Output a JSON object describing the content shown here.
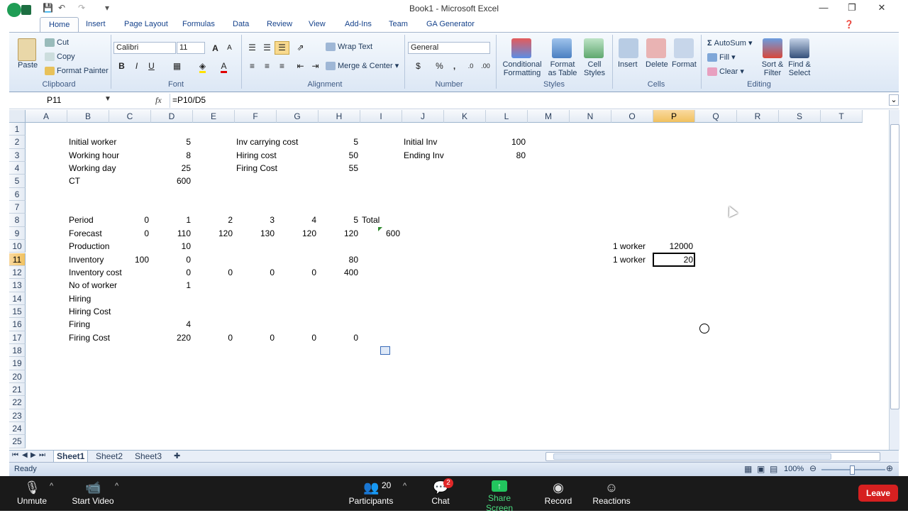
{
  "window": {
    "title": "Book1 - Microsoft Excel"
  },
  "ribbon_tabs": [
    "Home",
    "Insert",
    "Page Layout",
    "Formulas",
    "Data",
    "Review",
    "View",
    "Add-Ins",
    "Team",
    "GA Generator"
  ],
  "clipboard": {
    "paste": "Paste",
    "cut": "Cut",
    "copy": "Copy",
    "format_painter": "Format Painter",
    "label": "Clipboard"
  },
  "font": {
    "name": "Calibri",
    "size": "11",
    "label": "Font"
  },
  "alignment": {
    "wrap": "Wrap Text",
    "merge": "Merge & Center",
    "label": "Alignment"
  },
  "number": {
    "format": "General",
    "currency": "$",
    "percent": "%",
    "comma": ",",
    "label": "Number"
  },
  "styles": {
    "conditional_1": "Conditional",
    "conditional_2": "Formatting",
    "table_1": "Format",
    "table_2": "as Table",
    "cell_1": "Cell",
    "cell_2": "Styles",
    "label": "Styles"
  },
  "cells": {
    "insert": "Insert",
    "delete": "Delete",
    "format": "Format",
    "label": "Cells"
  },
  "editing": {
    "autosum": "AutoSum",
    "fill": "Fill",
    "clear": "Clear",
    "sort_1": "Sort &",
    "sort_2": "Filter",
    "find_1": "Find &",
    "find_2": "Select",
    "label": "Editing"
  },
  "formula_bar": {
    "name_box": "P11",
    "fx": "fx",
    "formula": "=P10/D5"
  },
  "columns": [
    "A",
    "B",
    "C",
    "D",
    "E",
    "F",
    "G",
    "H",
    "I",
    "J",
    "K",
    "L",
    "M",
    "N",
    "O",
    "P",
    "Q",
    "R",
    "S",
    "T"
  ],
  "rows": [
    "1",
    "2",
    "3",
    "4",
    "5",
    "6",
    "7",
    "8",
    "9",
    "10",
    "11",
    "12",
    "13",
    "14",
    "15",
    "16",
    "17",
    "18",
    "19",
    "20",
    "21",
    "22",
    "23",
    "24",
    "25"
  ],
  "cells_data": {
    "B2": "Initial worker",
    "D2": "5",
    "F2": "Inv carrying cost",
    "H2": "5",
    "J2": "Initial Inv",
    "L2": "100",
    "B3": "Working hour",
    "D3": "8",
    "F3": "Hiring cost",
    "H3": "50",
    "J3": "Ending Inv",
    "L3": "80",
    "B4": "Working day",
    "D4": "25",
    "F4": "Firing Cost",
    "H4": "55",
    "B5": "CT",
    "D5": "600",
    "B8": "Period",
    "C8": "0",
    "D8": "1",
    "E8": "2",
    "F8": "3",
    "G8": "4",
    "H8": "5",
    "I8": "Total",
    "B9": "Forecast",
    "C9": "0",
    "D9": "110",
    "E9": "120",
    "F9": "130",
    "G9": "120",
    "H9": "120",
    "I9": "600",
    "B10": "Production",
    "D10": "10",
    "O10": "1 worker",
    "P10": "12000",
    "B11": "Inventory",
    "C11": "100",
    "D11": "0",
    "H11": "80",
    "O11": "1 worker",
    "P11": "20",
    "B12": "Inventory cost",
    "D12": "0",
    "E12": "0",
    "F12": "0",
    "G12": "0",
    "H12": "400",
    "B13": "No of worker",
    "D13": "1",
    "B14": "Hiring",
    "B15": "Hiring Cost",
    "B16": "Firing",
    "D16": "4",
    "B17": "Firing Cost",
    "D17": "220",
    "E17": "0",
    "F17": "0",
    "G17": "0",
    "H17": "0"
  },
  "sheets": [
    "Sheet1",
    "Sheet2",
    "Sheet3"
  ],
  "status": {
    "ready": "Ready",
    "zoom": "100%"
  },
  "meeting": {
    "unmute": "Unmute",
    "start_video": "Start Video",
    "participants": "Participants",
    "participants_count": "20",
    "chat": "Chat",
    "chat_badge": "2",
    "share": "Share Screen",
    "record": "Record",
    "reactions": "Reactions",
    "leave": "Leave"
  },
  "colors": {
    "selection": "#f1c15f",
    "ribbon": "#dce7f5",
    "share_green": "#22c55e",
    "leave_red": "#d62020"
  }
}
